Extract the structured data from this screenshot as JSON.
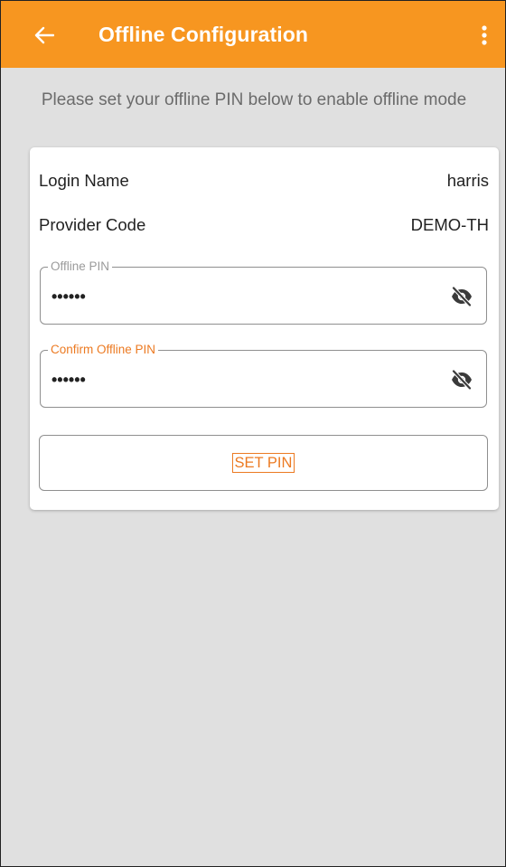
{
  "appbar": {
    "title": "Offline Configuration",
    "back_icon": "arrow-left-icon",
    "menu_icon": "more-vert-icon",
    "background": "#f79620"
  },
  "intro_text": "Please set your offline PIN below to enable offline mode",
  "account": {
    "login_name_label": "Login Name",
    "login_name_value": "harris",
    "provider_code_label": "Provider Code",
    "provider_code_value": "DEMO-TH"
  },
  "fields": {
    "offline_pin": {
      "label": "Offline PIN",
      "value": "••••••",
      "icon": "eye-off-icon"
    },
    "confirm_pin": {
      "label": "Confirm Offline PIN",
      "value": "••••••",
      "icon": "eye-off-icon",
      "label_color": "#ec7a22"
    }
  },
  "set_pin_button": {
    "label": "SET PIN",
    "color": "#ec7a22"
  }
}
